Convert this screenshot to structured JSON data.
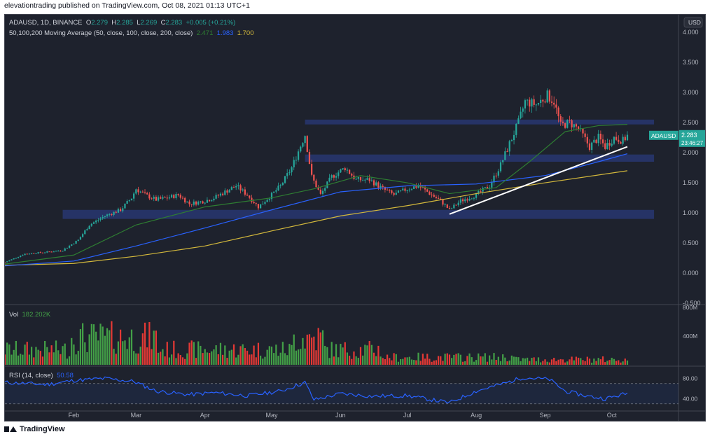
{
  "header": {
    "text": "elevationtrading published on TradingView.com, Oct 08, 2021 01:13 UTC+1"
  },
  "footer": {
    "brand": "TradingView"
  },
  "legend": {
    "symbol": "ADAUSD, 1D, BINANCE",
    "o_label": "O",
    "o": "2.279",
    "h_label": "H",
    "h": "2.285",
    "l_label": "L",
    "l": "2.269",
    "c_label": "C",
    "c": "2.283",
    "change": "+0.005 (+0.21%)",
    "ma_label": "50,100,200 Moving Average (50, close, 100, close, 200, close)",
    "ma50": "2.471",
    "ma100": "1.983",
    "ma200": "1.700",
    "vol_label": "Vol",
    "vol": "182.202K",
    "rsi_label": "RSI (14, close)",
    "rsi": "50.58"
  },
  "price_badge": {
    "symbol": "ADAUSD",
    "price": "2.283",
    "countdown": "23:46:27"
  },
  "colors": {
    "bg": "#1e222d",
    "up": "#26a69a",
    "down": "#ef5350",
    "ma50": "#2e7d32",
    "ma100": "#2962ff",
    "ma200": "#d4b93c",
    "zone": "#2a3a7a",
    "rsi": "#2962ff",
    "vol_up": "#43a047",
    "vol_down": "#e53935"
  },
  "chart_data": {
    "type": "candlestick",
    "currency_button": "USD",
    "price_axis": {
      "ticks": [
        "4.000",
        "3.500",
        "3.000",
        "2.500",
        "2.000",
        "1.500",
        "1.000",
        "0.500",
        "0.000",
        "-0.500"
      ],
      "ylim": [
        -0.5,
        4.2
      ]
    },
    "volume_axis": {
      "ticks": [
        "800M",
        "400M"
      ]
    },
    "rsi_axis": {
      "ticks": [
        "80.00",
        "40.00"
      ],
      "levels": [
        70,
        30
      ]
    },
    "x_ticks": [
      "Feb",
      "Mar",
      "Apr",
      "May",
      "Jun",
      "Jul",
      "Aug",
      "Sep",
      "Oct"
    ],
    "zones": [
      {
        "low": 2.47,
        "high": 2.55
      },
      {
        "low": 1.85,
        "high": 1.97
      },
      {
        "low": 0.9,
        "high": 1.05
      }
    ],
    "trendline": {
      "from": [
        "Jul 20",
        0.98
      ],
      "to": [
        "Oct 08",
        2.1
      ]
    },
    "price_path": [
      [
        "Jan 01",
        0.18
      ],
      [
        "Jan 10",
        0.32
      ],
      [
        "Jan 20",
        0.35
      ],
      [
        "Jan 27",
        0.38
      ],
      [
        "Feb 03",
        0.55
      ],
      [
        "Feb 08",
        0.8
      ],
      [
        "Feb 15",
        0.95
      ],
      [
        "Feb 22",
        1.05
      ],
      [
        "Feb 27",
        1.25
      ],
      [
        "Mar 01",
        1.4
      ],
      [
        "Mar 05",
        1.3
      ],
      [
        "Mar 10",
        1.22
      ],
      [
        "Mar 15",
        1.25
      ],
      [
        "Mar 20",
        1.3
      ],
      [
        "Mar 25",
        1.15
      ],
      [
        "Apr 01",
        1.2
      ],
      [
        "Apr 05",
        1.25
      ],
      [
        "Apr 10",
        1.35
      ],
      [
        "Apr 15",
        1.45
      ],
      [
        "Apr 20",
        1.3
      ],
      [
        "Apr 25",
        1.1
      ],
      [
        "May 01",
        1.3
      ],
      [
        "May 05",
        1.45
      ],
      [
        "May 10",
        1.75
      ],
      [
        "May 16",
        2.3
      ],
      [
        "May 19",
        1.6
      ],
      [
        "May 23",
        1.3
      ],
      [
        "May 28",
        1.6
      ],
      [
        "Jun 03",
        1.75
      ],
      [
        "Jun 08",
        1.55
      ],
      [
        "Jun 14",
        1.55
      ],
      [
        "Jun 20",
        1.4
      ],
      [
        "Jun 25",
        1.3
      ],
      [
        "Jul 01",
        1.4
      ],
      [
        "Jul 06",
        1.45
      ],
      [
        "Jul 10",
        1.35
      ],
      [
        "Jul 16",
        1.2
      ],
      [
        "Jul 20",
        1.05
      ],
      [
        "Jul 25",
        1.2
      ],
      [
        "Aug 01",
        1.3
      ],
      [
        "Aug 07",
        1.45
      ],
      [
        "Aug 12",
        1.8
      ],
      [
        "Aug 16",
        2.15
      ],
      [
        "Aug 20",
        2.5
      ],
      [
        "Aug 23",
        2.85
      ],
      [
        "Aug 28",
        2.8
      ],
      [
        "Sep 02",
        2.95
      ],
      [
        "Sep 05",
        2.85
      ],
      [
        "Sep 08",
        2.45
      ],
      [
        "Sep 12",
        2.5
      ],
      [
        "Sep 16",
        2.4
      ],
      [
        "Sep 21",
        2.1
      ],
      [
        "Sep 25",
        2.25
      ],
      [
        "Sep 28",
        2.1
      ],
      [
        "Oct 02",
        2.25
      ],
      [
        "Oct 06",
        2.2
      ],
      [
        "Oct 08",
        2.283
      ]
    ],
    "ma50": [
      [
        "Jan 01",
        0.15
      ],
      [
        "Feb 01",
        0.3
      ],
      [
        "Mar 01",
        0.8
      ],
      [
        "Apr 01",
        1.1
      ],
      [
        "May 01",
        1.25
      ],
      [
        "May 20",
        1.4
      ],
      [
        "Jun 10",
        1.62
      ],
      [
        "Jul 01",
        1.5
      ],
      [
        "Jul 20",
        1.32
      ],
      [
        "Aug 10",
        1.42
      ],
      [
        "Aug 25",
        1.85
      ],
      [
        "Sep 10",
        2.35
      ],
      [
        "Sep 25",
        2.45
      ],
      [
        "Oct 08",
        2.471
      ]
    ],
    "ma100": [
      [
        "Jan 01",
        0.12
      ],
      [
        "Feb 01",
        0.2
      ],
      [
        "Mar 01",
        0.45
      ],
      [
        "Apr 01",
        0.75
      ],
      [
        "May 01",
        1.05
      ],
      [
        "Jun 01",
        1.35
      ],
      [
        "Jul 01",
        1.45
      ],
      [
        "Aug 01",
        1.48
      ],
      [
        "Sep 01",
        1.62
      ],
      [
        "Sep 25",
        1.85
      ],
      [
        "Oct 08",
        1.983
      ]
    ],
    "ma200": [
      [
        "Jan 01",
        0.13
      ],
      [
        "Feb 01",
        0.16
      ],
      [
        "Mar 01",
        0.28
      ],
      [
        "Apr 01",
        0.45
      ],
      [
        "May 01",
        0.7
      ],
      [
        "Jun 01",
        0.95
      ],
      [
        "Jul 01",
        1.12
      ],
      [
        "Aug 01",
        1.32
      ],
      [
        "Sep 01",
        1.5
      ],
      [
        "Oct 08",
        1.7
      ]
    ],
    "rsi_path": [
      [
        "Jan 01",
        72
      ],
      [
        "Jan 20",
        68
      ],
      [
        "Feb 01",
        76
      ],
      [
        "Feb 15",
        80
      ],
      [
        "Feb 28",
        74
      ],
      [
        "Mar 10",
        55
      ],
      [
        "Mar 25",
        48
      ],
      [
        "Apr 05",
        52
      ],
      [
        "Apr 20",
        46
      ],
      [
        "May 05",
        55
      ],
      [
        "May 16",
        72
      ],
      [
        "May 20",
        38
      ],
      [
        "Jun 01",
        50
      ],
      [
        "Jun 15",
        45
      ],
      [
        "Jul 01",
        46
      ],
      [
        "Jul 20",
        32
      ],
      [
        "Aug 01",
        55
      ],
      [
        "Aug 15",
        72
      ],
      [
        "Aug 22",
        82
      ],
      [
        "Sep 03",
        78
      ],
      [
        "Sep 10",
        55
      ],
      [
        "Sep 20",
        45
      ],
      [
        "Sep 28",
        40
      ],
      [
        "Oct 08",
        50.58
      ]
    ]
  }
}
